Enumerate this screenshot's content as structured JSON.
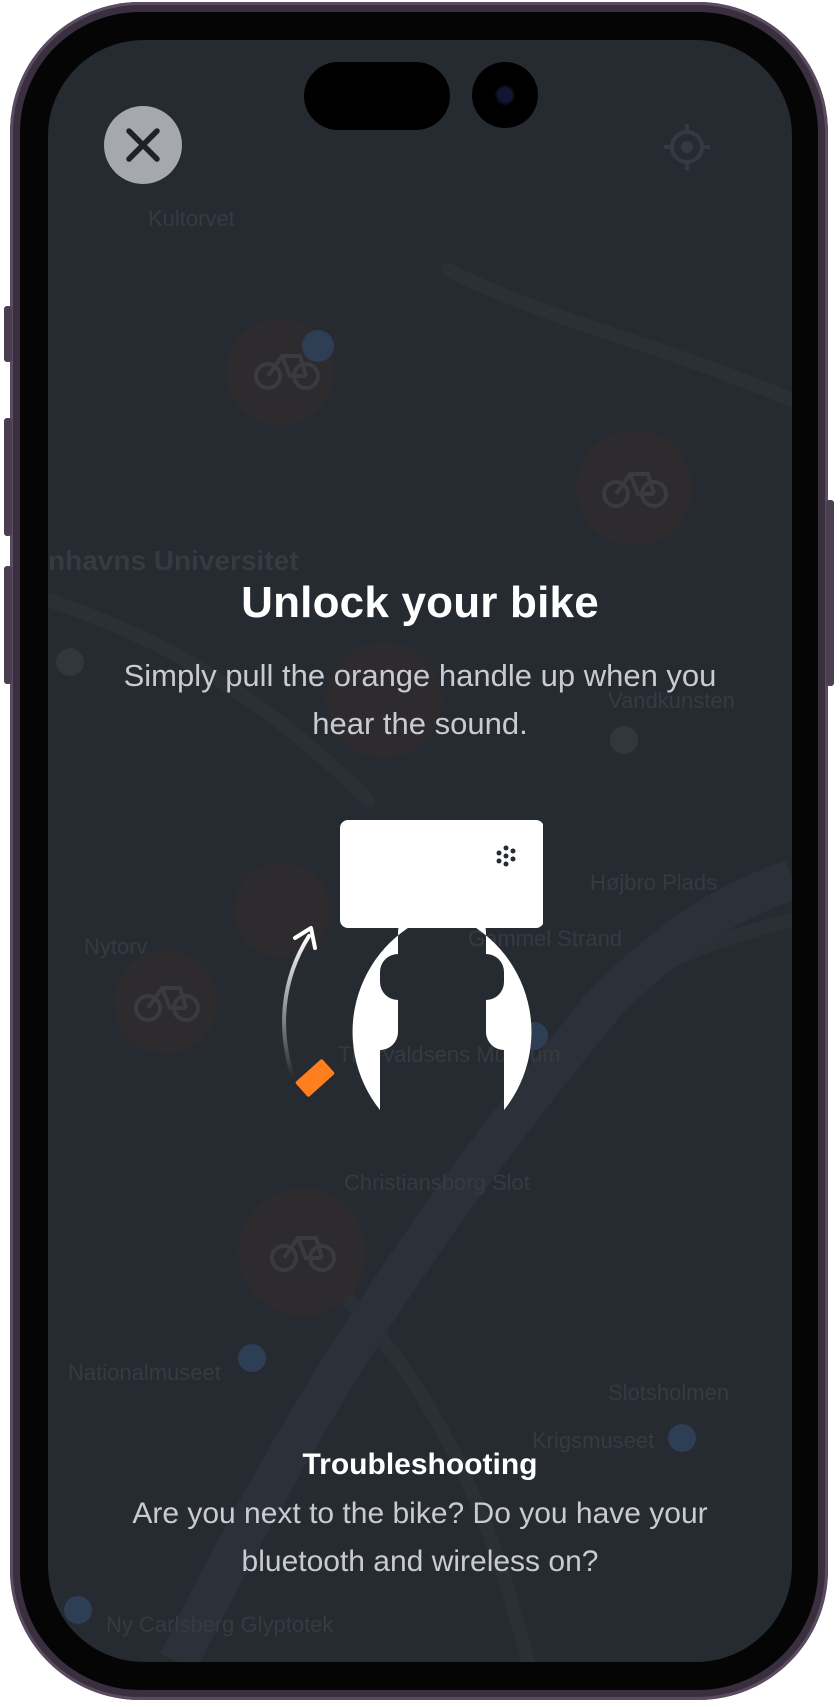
{
  "unlock": {
    "title": "Unlock your bike",
    "instruction": "Simply pull the orange handle up when you hear the sound."
  },
  "troubleshooting": {
    "title": "Troubleshooting",
    "text": "Are you next to the bike? Do you have your bluetooth and wireless on?"
  },
  "map_labels": {
    "kultorvet": "Kultorvet",
    "university": "Københavns Universitet",
    "nytorv": "Nytorv",
    "hojbro": "Højbro Plads",
    "gammel_strand": "Gammel Strand",
    "thorvaldsens": "Thorvaldsens Museum",
    "christiansborg": "Christiansborg Slot",
    "nationalmuseet": "Nationalmuseet",
    "slotsholmen": "Slotsholmen",
    "krigsmuseet": "Krigsmuseet",
    "glyptotek": "Ny Carlsberg Glyptotek",
    "vandet": "Vandkunsten"
  },
  "colors": {
    "accent_orange": "#ff7e1e",
    "overlay_bg": "#262a31",
    "close_button_bg": "#a6a8b0"
  },
  "icons": {
    "close": "close-icon",
    "locate": "crosshair-icon",
    "bike_marker": "bike-icon"
  }
}
